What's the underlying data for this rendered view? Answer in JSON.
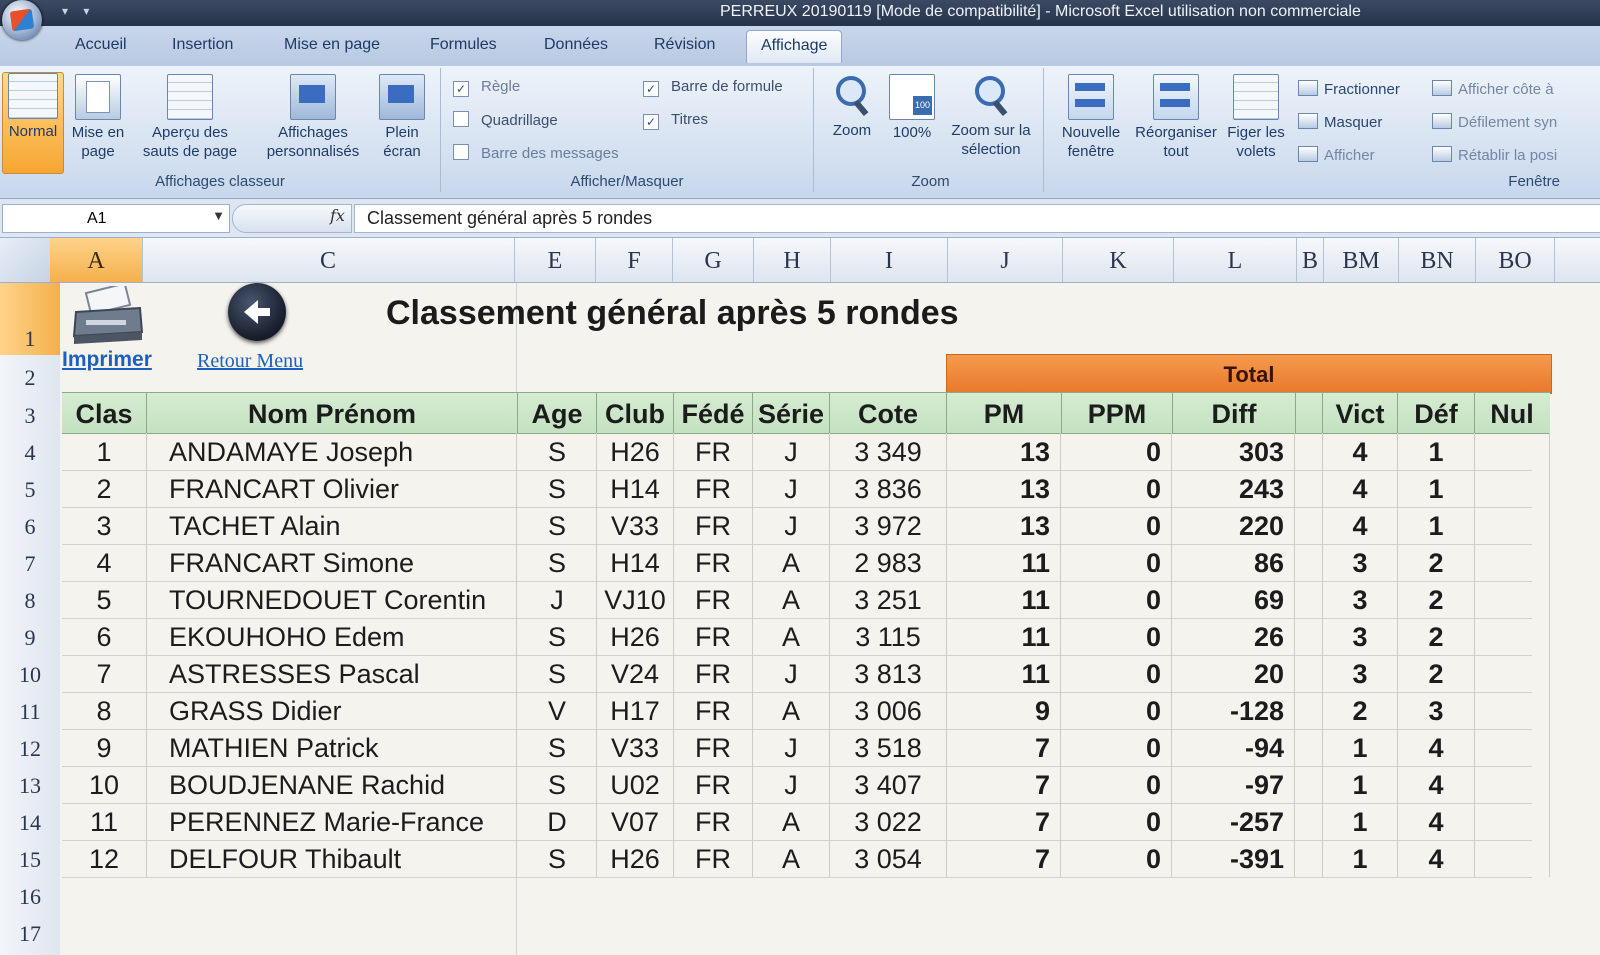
{
  "window": {
    "title": "PERREUX 20190119  [Mode de compatibilité] - Microsoft Excel utilisation non commerciale"
  },
  "ribbon": {
    "tabs": [
      "Accueil",
      "Insertion",
      "Mise en page",
      "Formules",
      "Données",
      "Révision",
      "Affichage"
    ],
    "active_tab": "Affichage",
    "groups": {
      "affichages_classeur": {
        "label": "Affichages classeur",
        "normal": "Normal",
        "mise_en_page": "Mise en page",
        "apercu": "Aperçu des sauts de page",
        "perso": "Affichages personnalisés",
        "plein": "Plein écran"
      },
      "afficher_masquer": {
        "label": "Afficher/Masquer",
        "regle": "Règle",
        "quadrillage": "Quadrillage",
        "barre_messages": "Barre des messages",
        "barre_formule": "Barre de formule",
        "titres": "Titres"
      },
      "zoom": {
        "label": "Zoom",
        "zoom": "Zoom",
        "cent": "100%",
        "zoom_sel": "Zoom sur la sélection"
      },
      "fenetre": {
        "label": "Fenêtre",
        "nouvelle": "Nouvelle fenêtre",
        "reorganiser": "Réorganiser tout",
        "figer": "Figer les volets",
        "fractionner": "Fractionner",
        "masquer": "Masquer",
        "afficher": "Afficher",
        "cote": "Afficher côte à",
        "defilement": "Défilement syn",
        "retablir": "Rétablir la posi"
      }
    }
  },
  "formula_bar": {
    "name_box": "A1",
    "fx": "fx",
    "content": "Classement général après 5 rondes"
  },
  "columns": [
    "A",
    "C",
    "E",
    "F",
    "G",
    "H",
    "I",
    "J",
    "K",
    "L",
    "B",
    "BM",
    "BN",
    "BO"
  ],
  "rows": [
    "1",
    "2",
    "3",
    "4",
    "5",
    "6",
    "7",
    "8",
    "9",
    "10",
    "11",
    "12",
    "13",
    "14",
    "15",
    "16",
    "17"
  ],
  "sheet": {
    "print_label": "Imprimer",
    "back_label": "Retour Menu",
    "title": "Classement général après 5 rondes",
    "total_label": "Total",
    "headers": [
      "Clas",
      "Nom Prénom",
      "Age",
      "Club",
      "Fédé",
      "Série",
      "Cote",
      "PM",
      "PPM",
      "Diff",
      "Vict",
      "Déf",
      "Nul"
    ],
    "table": [
      [
        "1",
        "ANDAMAYE Joseph",
        "S",
        "H26",
        "FR",
        "J",
        "3 349",
        "13",
        "0",
        "303",
        "4",
        "1",
        ""
      ],
      [
        "2",
        "FRANCART Olivier",
        "S",
        "H14",
        "FR",
        "J",
        "3 836",
        "13",
        "0",
        "243",
        "4",
        "1",
        ""
      ],
      [
        "3",
        "TACHET Alain",
        "S",
        "V33",
        "FR",
        "J",
        "3 972",
        "13",
        "0",
        "220",
        "4",
        "1",
        ""
      ],
      [
        "4",
        "FRANCART Simone",
        "S",
        "H14",
        "FR",
        "A",
        "2 983",
        "11",
        "0",
        "86",
        "3",
        "2",
        ""
      ],
      [
        "5",
        "TOURNEDOUET Corentin",
        "J",
        "VJ10",
        "FR",
        "A",
        "3 251",
        "11",
        "0",
        "69",
        "3",
        "2",
        ""
      ],
      [
        "6",
        "EKOUHOHO Edem",
        "S",
        "H26",
        "FR",
        "A",
        "3 115",
        "11",
        "0",
        "26",
        "3",
        "2",
        ""
      ],
      [
        "7",
        "ASTRESSES Pascal",
        "S",
        "V24",
        "FR",
        "J",
        "3 813",
        "11",
        "0",
        "20",
        "3",
        "2",
        ""
      ],
      [
        "8",
        "GRASS Didier",
        "V",
        "H17",
        "FR",
        "A",
        "3 006",
        "9",
        "0",
        "-128",
        "2",
        "3",
        ""
      ],
      [
        "9",
        "MATHIEN Patrick",
        "S",
        "V33",
        "FR",
        "J",
        "3 518",
        "7",
        "0",
        "-94",
        "1",
        "4",
        ""
      ],
      [
        "10",
        "BOUDJENANE Rachid",
        "S",
        "U02",
        "FR",
        "J",
        "3 407",
        "7",
        "0",
        "-97",
        "1",
        "4",
        ""
      ],
      [
        "11",
        "PERENNEZ Marie-France",
        "D",
        "V07",
        "FR",
        "A",
        "3 022",
        "7",
        "0",
        "-257",
        "1",
        "4",
        ""
      ],
      [
        "12",
        "DELFOUR Thibault",
        "S",
        "H26",
        "FR",
        "A",
        "3 054",
        "7",
        "0",
        "-391",
        "1",
        "4",
        ""
      ]
    ]
  },
  "colors": {
    "accent_orange": "#e8792b",
    "header_green": "#c3e2c0",
    "link_blue": "#1f5fbf"
  }
}
